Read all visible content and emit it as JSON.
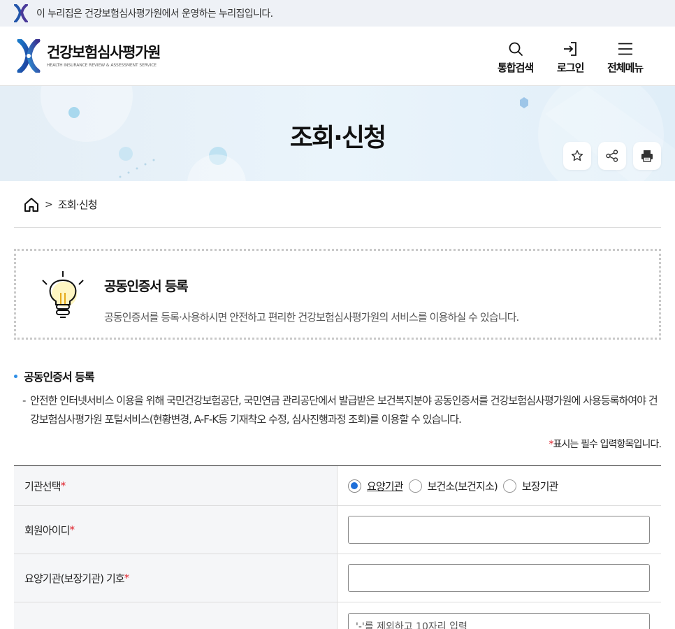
{
  "gov_notice": {
    "text": "이 누리집은 건강보험심사평가원에서 운영하는 누리집입니다."
  },
  "header": {
    "org_name": "건강보험심사평가원",
    "org_name_en": "HEALTH INSURANCE REVIEW & ASSESSMENT SERVICE",
    "utilities": {
      "search": "통합검색",
      "login": "로그인",
      "menu": "전체메뉴"
    }
  },
  "hero": {
    "title": "조회·신청"
  },
  "breadcrumb": {
    "separator": ">",
    "current": "조회·신청"
  },
  "info_box": {
    "title": "공동인증서 등록",
    "description": "공동인증서를 등록·사용하시면 안전하고 편리한 건강보험심사평가원의 서비스를 이용하실 수 있습니다."
  },
  "section": {
    "title": "공동인증서 등록",
    "dash": "-",
    "description": "안전한 인터넷서비스 이용을 위해 국민건강보험공단, 국민연금 관리공단에서 발급받은 보건복지분야 공동인증서를 건강보험심사평가원에 사용등록하여야 건강보험심사평가원 포털서비스(현황변경, A-F-K등 기재착오 수정, 심사진행과정 조회)를 이용할 수 있습니다.",
    "required_note_star": "*",
    "required_note": "표시는 필수 입력항목입니다."
  },
  "form": {
    "required_mark": "*",
    "institution": {
      "label": "기관선택",
      "options": [
        "요양기관",
        "보건소(보건지소)",
        "보장기관"
      ],
      "selected": "요양기관"
    },
    "member_id": {
      "label": "회원아이디",
      "value": ""
    },
    "institution_code": {
      "label": "요양기관(보장기관) 기호",
      "value": ""
    },
    "fourth": {
      "label": "",
      "placeholder": "'-'를 제외하고 10자리 입력"
    }
  },
  "colors": {
    "accent": "#1e6fd9",
    "required": "#e0262f",
    "section_dot": "#2d8ee6"
  }
}
